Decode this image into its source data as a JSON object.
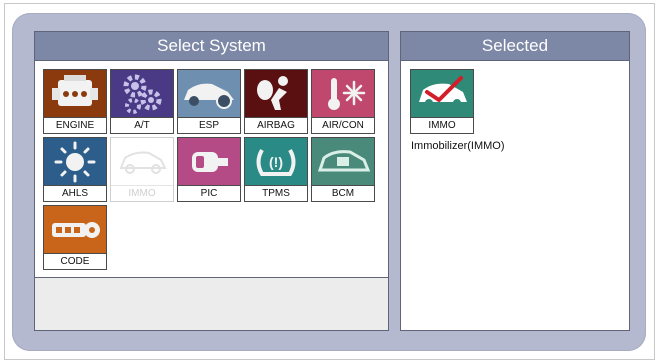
{
  "left_panel": {
    "title": "Select System"
  },
  "right_panel": {
    "title": "Selected",
    "selected_label": "IMMO",
    "selected_description": "Immobilizer(IMMO)"
  },
  "systems": [
    {
      "label": "ENGINE",
      "icon": "engine-icon",
      "bg": "#8b3a0d",
      "enabled": true
    },
    {
      "label": "A/T",
      "icon": "gears-icon",
      "bg": "#4a3a86",
      "enabled": true
    },
    {
      "label": "ESP",
      "icon": "car-brake-icon",
      "bg": "#6f8fb0",
      "enabled": true
    },
    {
      "label": "AIRBAG",
      "icon": "airbag-icon",
      "bg": "#5a1010",
      "enabled": true
    },
    {
      "label": "AIR/CON",
      "icon": "thermometer-snow-icon",
      "bg": "#c0476e",
      "enabled": true
    },
    {
      "label": "AHLS",
      "icon": "headlight-icon",
      "bg": "#2d5d8a",
      "enabled": true
    },
    {
      "label": "IMMO",
      "icon": "immobilizer-icon",
      "bg": "#ffffff",
      "enabled": false
    },
    {
      "label": "PIC",
      "icon": "smart-key-icon",
      "bg": "#b44a86",
      "enabled": true
    },
    {
      "label": "TPMS",
      "icon": "tire-pressure-icon",
      "bg": "#2a8a86",
      "enabled": true
    },
    {
      "label": "BCM",
      "icon": "body-control-icon",
      "bg": "#4a8a7a",
      "enabled": true
    },
    {
      "label": "CODE",
      "icon": "key-code-icon",
      "bg": "#c8651a",
      "enabled": true
    }
  ]
}
